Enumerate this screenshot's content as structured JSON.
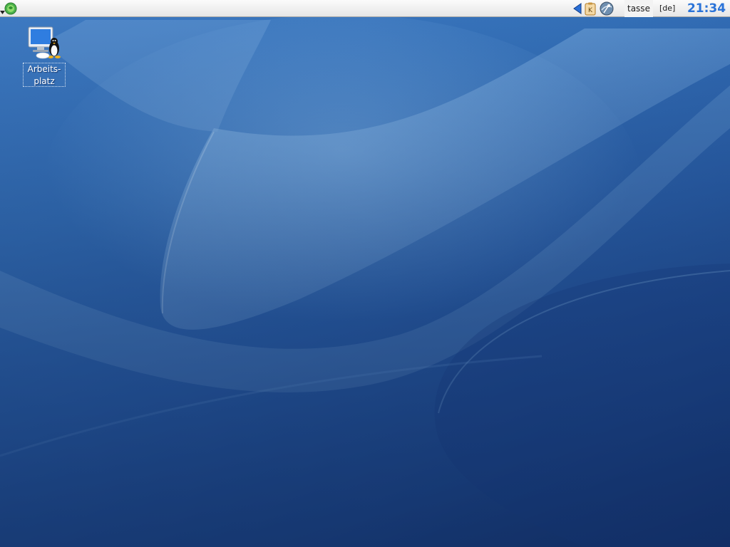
{
  "panel": {
    "menu_icon": "kmenu-icon",
    "tray": {
      "items": [
        {
          "name": "show-hidden-tray-icon"
        },
        {
          "name": "klipper-clipboard-icon",
          "glyph": "K"
        },
        {
          "name": "network-globe-icon"
        }
      ],
      "user": "tasse",
      "keyboard_layout": "[de]"
    },
    "clock": "21:34"
  },
  "desktop": {
    "icons": [
      {
        "name": "computer-icon",
        "label_line1": "Arbeits-",
        "label_line2": "platz"
      }
    ]
  },
  "colors": {
    "accent_clock": "#2a73d8",
    "wallpaper_base": "#3470b8",
    "panel_bg": "#ececec"
  }
}
